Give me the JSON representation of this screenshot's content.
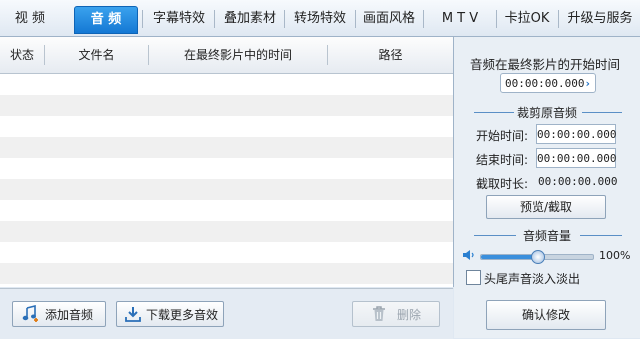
{
  "tabs": [
    {
      "label": "视  频"
    },
    {
      "label": "音  频"
    },
    {
      "label": "字幕特效"
    },
    {
      "label": "叠加素材"
    },
    {
      "label": "转场特效"
    },
    {
      "label": "画面风格"
    },
    {
      "label": "M T V"
    },
    {
      "label": "卡拉OK"
    },
    {
      "label": "升级与服务"
    }
  ],
  "active_tab": "音  频",
  "list": {
    "columns": [
      {
        "label": "状态"
      },
      {
        "label": "文件名"
      },
      {
        "label": "在最终影片中的时间"
      },
      {
        "label": "路径"
      }
    ],
    "rows": []
  },
  "bottom_bar": {
    "add_audio": "添加音频",
    "download_more": "下载更多音效",
    "delete": "删除"
  },
  "right_panel": {
    "start_time_title": "音频在最终影片的开始时间",
    "start_time_value": "00:00:00.000",
    "trim_section_title": "裁剪原音频",
    "start_label": "开始时间:",
    "start_value": "00:00:00.000",
    "end_label": "结束时间:",
    "end_value": "00:00:00.000",
    "duration_label": "截取时长:",
    "duration_value": "00:00:00.000",
    "preview_button": "预览/截取",
    "volume_section_title": "音频音量",
    "volume_value": "100%",
    "volume_level": 0.5,
    "fade_label": "头尾声音淡入淡出",
    "fade_checked": false,
    "confirm_button": "确认修改"
  },
  "colors": {
    "accent": "#1478d4",
    "panel_bg": "#e9eff5",
    "row_alt": "#f0f0f0"
  }
}
